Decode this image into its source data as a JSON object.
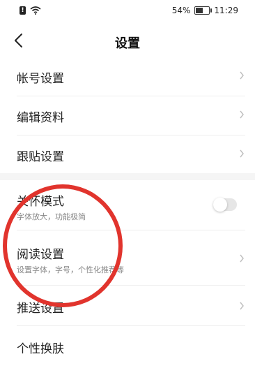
{
  "status_bar": {
    "sim_label": "!",
    "battery_text": "54%",
    "battery_level": 0.54,
    "time": "11:29"
  },
  "header": {
    "title": "设置"
  },
  "settings": {
    "account": "帐号设置",
    "edit_profile": "编辑资料",
    "post_settings": "跟贴设置",
    "care_mode": {
      "label": "关怀模式",
      "description": "字体放大，功能极简",
      "enabled": false
    },
    "reading": {
      "label": "阅读设置",
      "description": "设置字体，字号，个性化推荐等"
    },
    "push": "推送设置",
    "theme": "个性换肤"
  },
  "colors": {
    "annotation": "#e1342d",
    "chevron": "#c0c0c0"
  }
}
